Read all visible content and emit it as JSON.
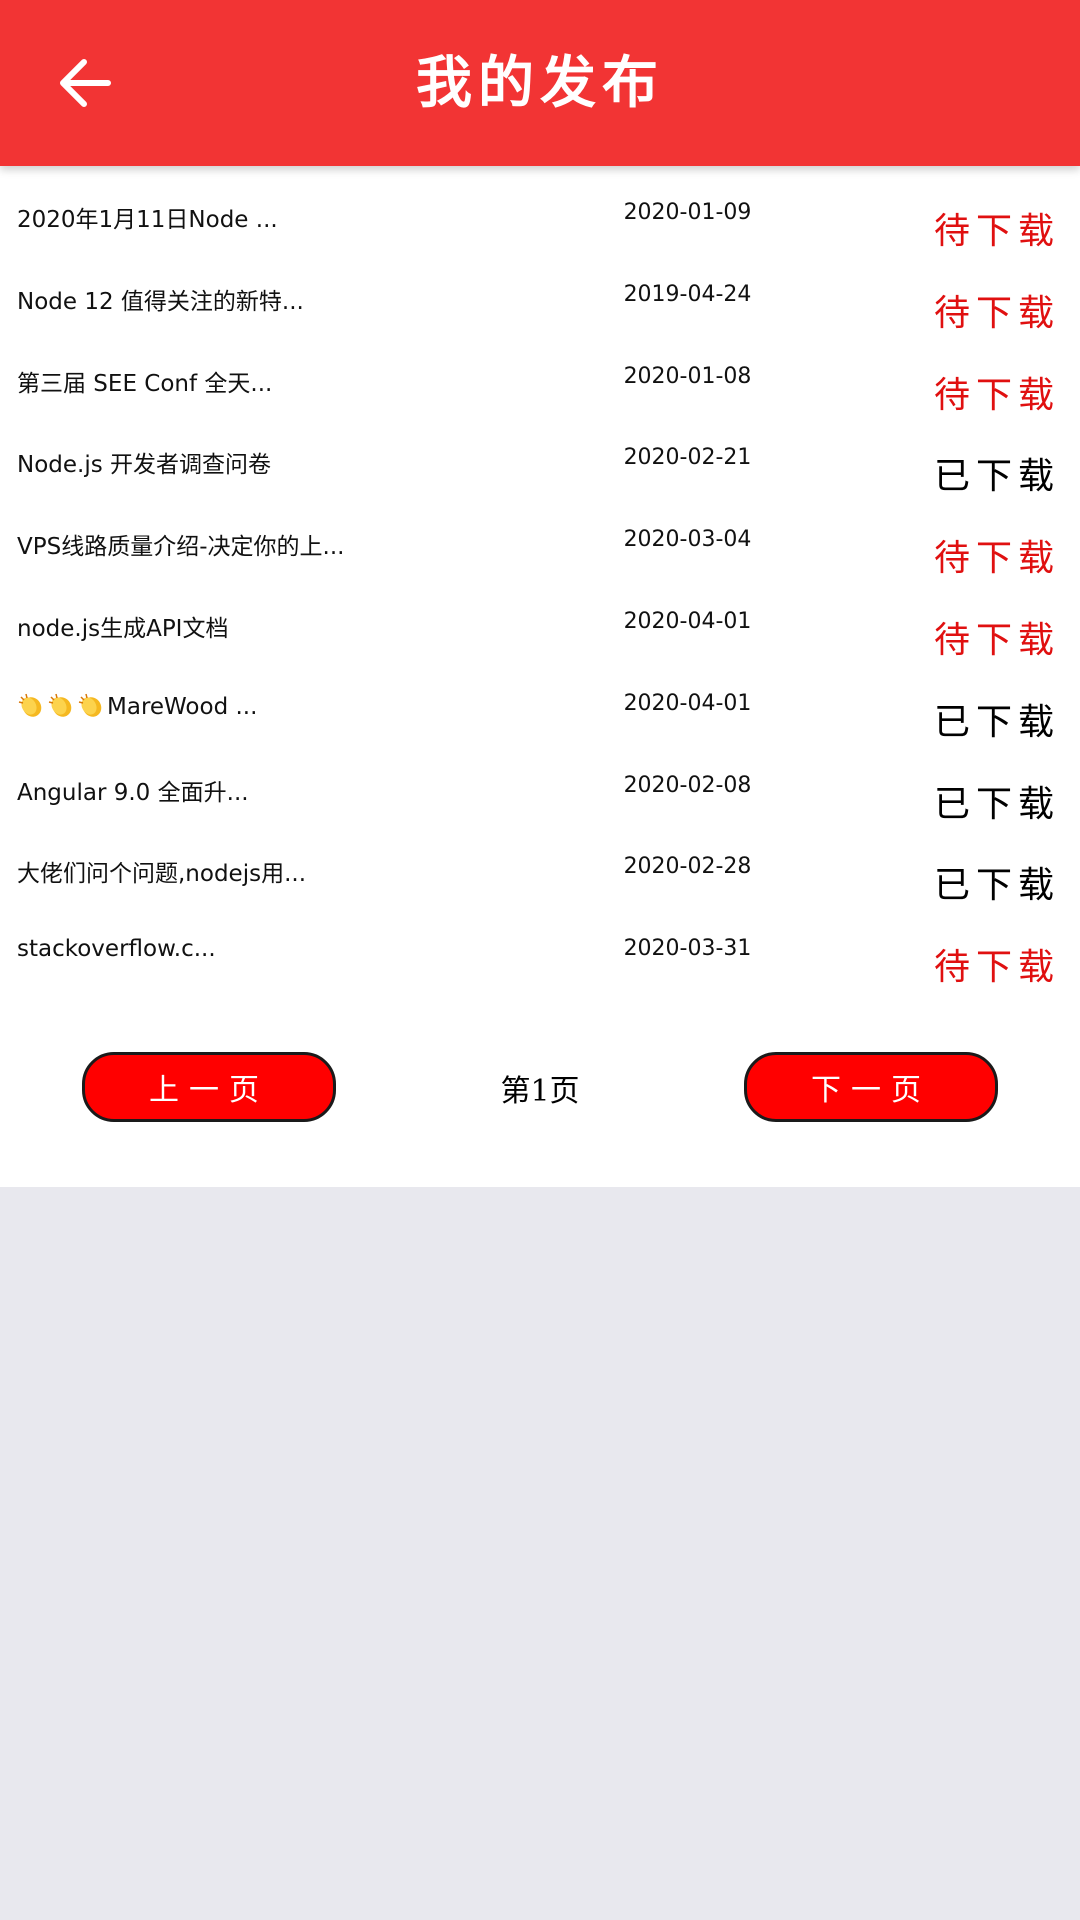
{
  "header": {
    "title": "我的发布",
    "back_icon": "arrow-left-icon"
  },
  "colors": {
    "header_bg": "#f23434",
    "pending_status": "#e01010",
    "done_status": "#000000",
    "pager_button": "#ff0000",
    "page_bg": "#e8e8ee"
  },
  "list": {
    "rows": [
      {
        "title": "2020年1月11日Node ...",
        "date": "2020-01-09",
        "status": "待下载",
        "state": "pending"
      },
      {
        "title": "Node 12 值得关注的新特...",
        "date": "2019-04-24",
        "status": "待下载",
        "state": "pending"
      },
      {
        "title": "第三届 SEE Conf 全天...",
        "date": "2020-01-08",
        "status": "待下载",
        "state": "pending"
      },
      {
        "title": "Node.js 开发者调查问卷",
        "date": "2020-02-21",
        "status": "已下载",
        "state": "done"
      },
      {
        "title": "VPS线路质量介绍-决定你的上...",
        "date": "2020-03-04",
        "status": "待下载",
        "state": "pending"
      },
      {
        "title": "node.js生成API文档",
        "date": "2020-04-01",
        "status": "待下载",
        "state": "pending"
      },
      {
        "title": "MareWood ...",
        "date": "2020-04-01",
        "status": "已下载",
        "state": "done",
        "emoji_prefix": "clapping-hands-icon x3"
      },
      {
        "title": "Angular 9.0 全面升...",
        "date": "2020-02-08",
        "status": "已下载",
        "state": "done"
      },
      {
        "title": "大佬们问个问题,nodejs用...",
        "date": "2020-02-28",
        "status": "已下载",
        "state": "done"
      },
      {
        "title": "stackoverflow.c...",
        "date": "2020-03-31",
        "status": "待下载",
        "state": "pending"
      }
    ]
  },
  "pager": {
    "prev_label": "上一页",
    "next_label": "下一页",
    "page_label": "第1页"
  }
}
